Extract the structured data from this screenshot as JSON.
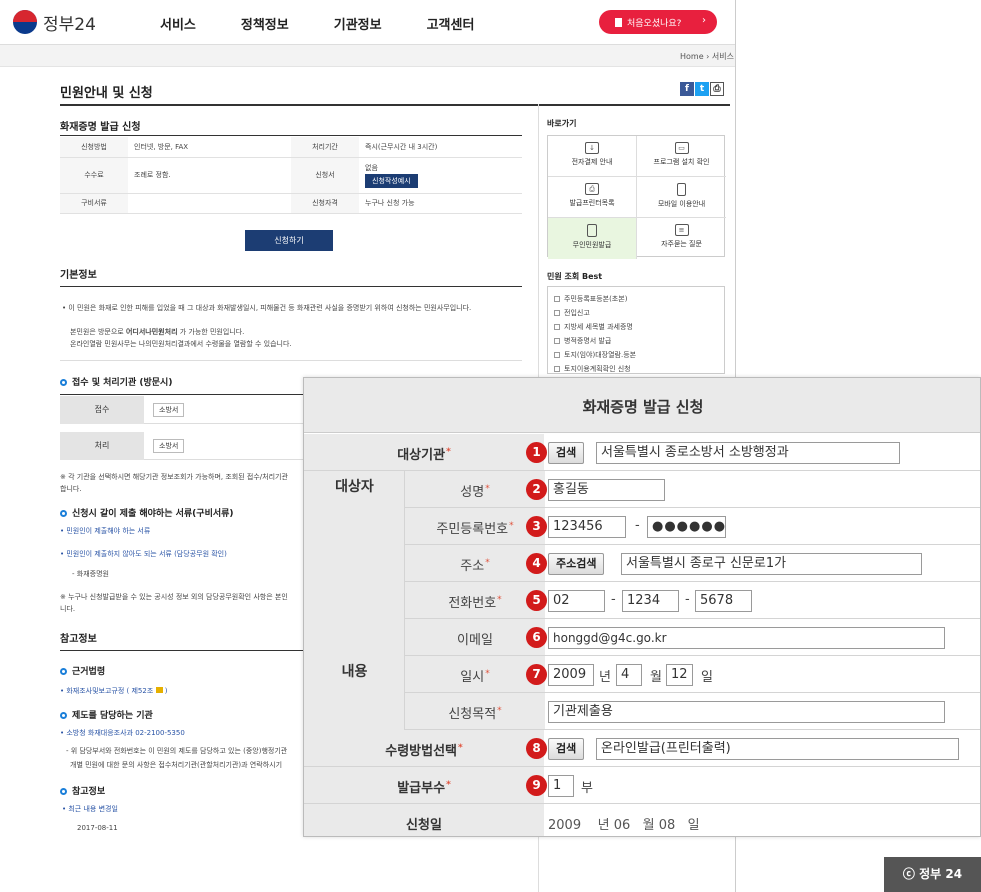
{
  "header": {
    "logo_text": "정부24",
    "nav": [
      "서비스",
      "정책정보",
      "기관정보",
      "고객센터"
    ],
    "first_visit": "처음오셨나요?",
    "first_visit_arrow": "›"
  },
  "breadcrumb": "Home  ›  서비스",
  "page_title": "민원안내 및 신청",
  "share": {
    "facebook": "f",
    "twitter": "t",
    "print": "⎙"
  },
  "apply_section": {
    "heading": "화재증명 발급 신청",
    "rows": [
      {
        "k1": "신청방법",
        "v1": "인터넷, 방문, FAX",
        "k2": "처리기간",
        "v2": "즉시(근무시간 내 3시간)"
      },
      {
        "k1": "수수료",
        "v1": "조례로 정함.",
        "k2": "신청서",
        "v2": "없음",
        "v2_btn": "신청작성예시"
      },
      {
        "k1": "구비서류",
        "v1": "",
        "k2": "신청자격",
        "v2": "누구나 신청 가능"
      }
    ],
    "apply_button": "신청하기"
  },
  "basic_info": {
    "heading": "기본정보",
    "line1": "•  이 민원은 화재로 인한 피해를 입었을 때 그 대상과 화재발생일시, 피해물건 등 화재관련 사실을 증명받기 위하여 신청하는 민원사무입니다.",
    "line2_pre": "본민원은 방문으로 ",
    "line2_bold": "어디서나민원처리",
    "line2_post": " 가 가능한 민원입니다.",
    "line3": "온라인열람 민원사무는 나의민원처리결과에서 수령물을 열람할 수 있습니다."
  },
  "reception": {
    "heading": "접수 및 처리기관 (방문시)",
    "rows": [
      {
        "k": "접수",
        "v": "소방서"
      },
      {
        "k": "처리",
        "v": "소방서"
      }
    ],
    "note1": "※ 각 기관을 선택하시면 해당기관 정보조회가 가능하며, 조회된 접수/처리기관",
    "note2": "합니다."
  },
  "documents": {
    "heading": "신청시 같이 제출 해야하는 서류(구비서류)",
    "item1": "•  민원인이 제출해야 하는 서류",
    "item2": "•  민원인이 제출하지 않아도 되는 서류 (담당공무원 확인)",
    "item2_sub": "- 화재증명원",
    "note1": "※ 누구나 신청발급받을 수 있는 공시성 정보 외의 담당공무원확인 사항은 본인",
    "note2": "니다."
  },
  "reference": {
    "heading": "참고정보",
    "law_heading": "근거법령",
    "law_item": "•  화재조사및보고규정 ( 제52조 ",
    "law_item_end": " )",
    "org_heading": "제도를 담당하는 기관",
    "org_item": "•  소방청  화재대응조사과 02-2100-5350",
    "org_note1": "- 위 담당부서와 전화번호는 이 민원의 제도를 담당하고 있는 (중앙)행정기관",
    "org_note2": "개별 민원에 대한 문의 사항은 접수처리기관(관할처리기관)과 연락하시기",
    "ref_heading": "참고정보",
    "ref_item": "•  최근 내용 변경일",
    "ref_date": "2017-08-11"
  },
  "sidebar": {
    "quick_heading": "바로가기",
    "quick": [
      {
        "label": "전자결제 안내",
        "icon": "download-icon"
      },
      {
        "label": "프로그램 설치 확인",
        "icon": "monitor-icon"
      },
      {
        "label": "발급프린터목록",
        "icon": "printer-icon"
      },
      {
        "label": "모바일 이용안내",
        "icon": "mobile-icon"
      },
      {
        "label": "무인민원발급",
        "icon": "kiosk-icon"
      },
      {
        "label": "자주묻는 질문",
        "icon": "chat-icon"
      }
    ],
    "best_heading": "민원 조회 Best",
    "best": [
      "주민등록표등본(초본)",
      "전입신고",
      "지방세 세목별 과세증명",
      "병적증명서 발급",
      "토지(임야)대장열람.등본",
      "토지이용계획확인 신청"
    ]
  },
  "form": {
    "title": "화재증명 발급 신청",
    "group_target": "대상자",
    "group_content": "내용",
    "search_btn": "검색",
    "address_btn": "주소검색",
    "fields": {
      "agency_label": "대상기관",
      "agency_value": "서울특별시 종로소방서 소방행정과",
      "name_label": "성명",
      "name_value": "홍길동",
      "rrn_label": "주민등록번호",
      "rrn_front": "123456",
      "rrn_back": "●●●●●●",
      "address_label": "주소",
      "address_value": "서울특별시 종로구 신문로1가",
      "phone_label": "전화번호",
      "phone1": "02",
      "phone2": "1234",
      "phone3": "5678",
      "email_label": "이메일",
      "email_value": "honggd@g4c.go.kr",
      "datetime_label": "일시",
      "year": "2009",
      "month": "4",
      "day": "12",
      "purpose_label": "신청목적",
      "purpose_value": "기관제출용",
      "receive_label": "수령방법선택",
      "receive_value": "온라인발급(프린터출력)",
      "copies_label": "발급부수",
      "copies_value": "1",
      "apply_date_label": "신청일",
      "apply_date": "2009    년 06   월 08   일"
    },
    "units": {
      "year": "년",
      "month": "월",
      "day": "일",
      "copies": "부",
      "dash": "-",
      "required": "*"
    },
    "numbers": [
      "1",
      "2",
      "3",
      "4",
      "5",
      "6",
      "7",
      "8",
      "9"
    ]
  },
  "copyright_badge": "ⓒ 정부 24"
}
